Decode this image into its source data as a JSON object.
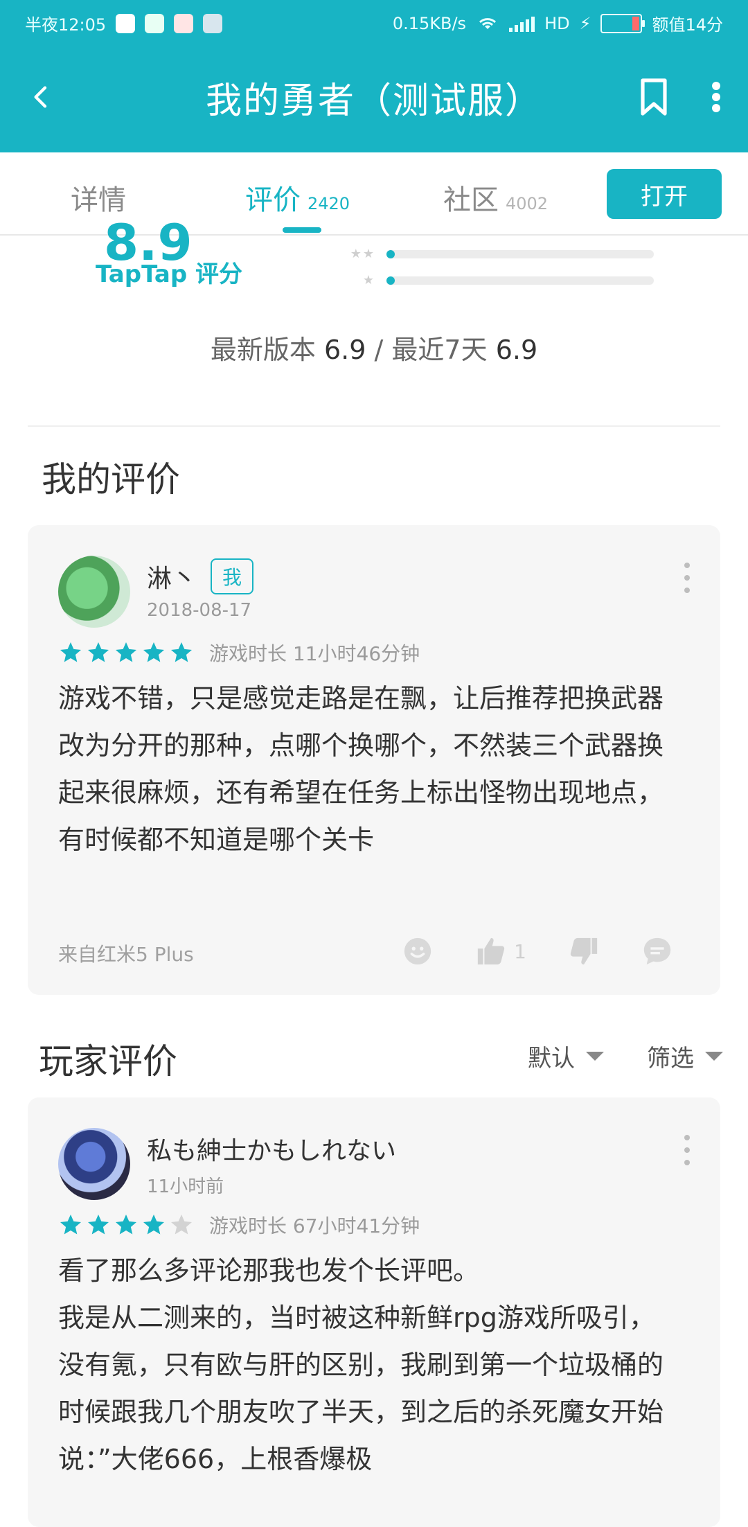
{
  "status_bar": {
    "time": "半夜12:05",
    "network": "0.15KB/s",
    "hd": "HD",
    "tip": "额值14分"
  },
  "app_bar": {
    "title": "我的勇者（测试服）"
  },
  "tabs": {
    "details": "详情",
    "reviews": "评价",
    "reviews_count": "2420",
    "community": "社区",
    "community_count": "4002",
    "open_button": "打开"
  },
  "score": {
    "value": "8.9",
    "source_label": "TapTap 评分",
    "rows": [
      {
        "stars_label": "★★",
        "value_fraction": 0.03
      },
      {
        "stars_label": "★",
        "value_fraction": 0.03
      }
    ],
    "latest_version_label": "最新版本",
    "latest_version_value": "6.9",
    "recent7_label": "最近7天",
    "recent7_value": "6.9",
    "separator": "/"
  },
  "my_review": {
    "section_title": "我的评价",
    "user": {
      "name": "淋丶",
      "tag": "我",
      "date": "2018-08-17"
    },
    "rating": 5,
    "playtime": "游戏时长 11小时46分钟",
    "text": "游戏不错，只是感觉走路是在飘，让后推荐把换武器改为分开的那种，点哪个换哪个，不然装三个武器换起来很麻烦，还有希望在任务上标出怪物出现地点，有时候都不知道是哪个关卡",
    "device": "来自红米5 Plus",
    "likes": "1"
  },
  "player_reviews": {
    "section_title": "玩家评价",
    "sort_label": "默认",
    "filter_label": "筛选",
    "first": {
      "name": "私も紳士かもしれない",
      "time_ago": "11小时前",
      "rating": 4,
      "playtime": "游戏时长 67小时41分钟",
      "text": "看了那么多评论那我也发个长评吧。\n我是从二测来的，当时被这种新鲜rpg游戏所吸引，没有氪，只有欧与肝的区别，我刷到第一个垃圾桶的时候跟我几个朋友吹了半天，到之后的杀死魔女开始说：”大佬666，上根香爆极"
    }
  },
  "colors": {
    "brand": "#18b4c4",
    "card_bg": "#f6f6f6",
    "star_on": "#18b4c4",
    "star_off": "#d3d3d3"
  }
}
